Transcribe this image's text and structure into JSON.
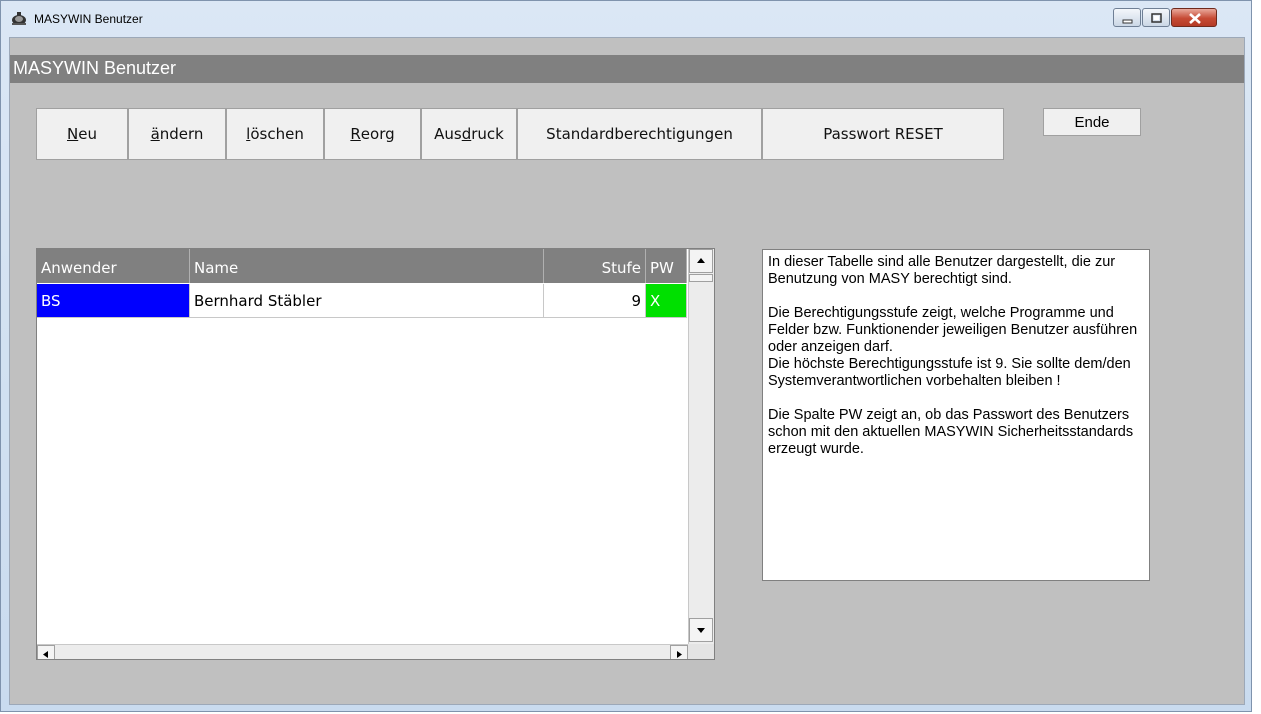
{
  "window": {
    "title": "MASYWIN Benutzer",
    "icon": "masywin-app-icon",
    "controls": [
      "minimize-icon",
      "maximize-icon",
      "close-icon"
    ]
  },
  "header": {
    "title": "MASYWIN Benutzer"
  },
  "toolbar": {
    "neu": {
      "pre": "",
      "accel": "N",
      "post": "eu"
    },
    "aendern": {
      "pre": "",
      "accel": "ä",
      "post": "ndern"
    },
    "loeschen": {
      "pre": "",
      "accel": "l",
      "post": "öschen"
    },
    "reorg": {
      "pre": "",
      "accel": "R",
      "post": "eorg"
    },
    "ausdruck": {
      "pre": "Aus",
      "accel": "d",
      "post": "ruck"
    },
    "standard": "Standardberechtigungen",
    "passwort_reset": "Passwort RESET",
    "ende": "Ende"
  },
  "table": {
    "columns": [
      "Anwender",
      "Name",
      "Stufe",
      "PW"
    ],
    "rows": [
      {
        "anwender": "BS",
        "name": "Bernhard Stäbler",
        "stufe": "9",
        "pw": "X"
      }
    ]
  },
  "info_text": "In dieser Tabelle sind alle Benutzer dargestellt, die zur Benutzung von MASY berechtigt sind.\n\nDie Berechtigungsstufe zeigt, welche Programme und Felder bzw. Funktionender jeweiligen Benutzer ausführen  oder anzeigen darf.\nDie höchste Berechtigungsstufe ist 9. Sie sollte dem/den Systemverantwortlichen vorbehalten bleiben !\n\nDie Spalte PW zeigt an, ob das Passwort des Benutzers schon mit den aktuellen MASYWIN Sicherheitsstandards erzeugt wurde.",
  "colors": {
    "selected_cell": "#0000ff",
    "pw_ok": "#00e000",
    "header_gray": "#808080",
    "client_gray": "#c0c0c0"
  }
}
